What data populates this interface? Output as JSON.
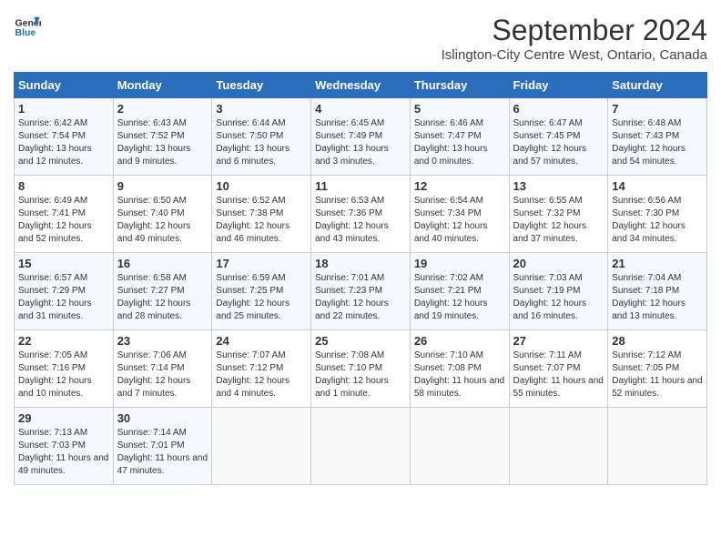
{
  "logo": {
    "line1": "General",
    "line2": "Blue"
  },
  "title": "September 2024",
  "subtitle": "Islington-City Centre West, Ontario, Canada",
  "days_header": [
    "Sunday",
    "Monday",
    "Tuesday",
    "Wednesday",
    "Thursday",
    "Friday",
    "Saturday"
  ],
  "weeks": [
    [
      {
        "num": "1",
        "sunrise": "Sunrise: 6:42 AM",
        "sunset": "Sunset: 7:54 PM",
        "daylight": "Daylight: 13 hours and 12 minutes."
      },
      {
        "num": "2",
        "sunrise": "Sunrise: 6:43 AM",
        "sunset": "Sunset: 7:52 PM",
        "daylight": "Daylight: 13 hours and 9 minutes."
      },
      {
        "num": "3",
        "sunrise": "Sunrise: 6:44 AM",
        "sunset": "Sunset: 7:50 PM",
        "daylight": "Daylight: 13 hours and 6 minutes."
      },
      {
        "num": "4",
        "sunrise": "Sunrise: 6:45 AM",
        "sunset": "Sunset: 7:49 PM",
        "daylight": "Daylight: 13 hours and 3 minutes."
      },
      {
        "num": "5",
        "sunrise": "Sunrise: 6:46 AM",
        "sunset": "Sunset: 7:47 PM",
        "daylight": "Daylight: 13 hours and 0 minutes."
      },
      {
        "num": "6",
        "sunrise": "Sunrise: 6:47 AM",
        "sunset": "Sunset: 7:45 PM",
        "daylight": "Daylight: 12 hours and 57 minutes."
      },
      {
        "num": "7",
        "sunrise": "Sunrise: 6:48 AM",
        "sunset": "Sunset: 7:43 PM",
        "daylight": "Daylight: 12 hours and 54 minutes."
      }
    ],
    [
      {
        "num": "8",
        "sunrise": "Sunrise: 6:49 AM",
        "sunset": "Sunset: 7:41 PM",
        "daylight": "Daylight: 12 hours and 52 minutes."
      },
      {
        "num": "9",
        "sunrise": "Sunrise: 6:50 AM",
        "sunset": "Sunset: 7:40 PM",
        "daylight": "Daylight: 12 hours and 49 minutes."
      },
      {
        "num": "10",
        "sunrise": "Sunrise: 6:52 AM",
        "sunset": "Sunset: 7:38 PM",
        "daylight": "Daylight: 12 hours and 46 minutes."
      },
      {
        "num": "11",
        "sunrise": "Sunrise: 6:53 AM",
        "sunset": "Sunset: 7:36 PM",
        "daylight": "Daylight: 12 hours and 43 minutes."
      },
      {
        "num": "12",
        "sunrise": "Sunrise: 6:54 AM",
        "sunset": "Sunset: 7:34 PM",
        "daylight": "Daylight: 12 hours and 40 minutes."
      },
      {
        "num": "13",
        "sunrise": "Sunrise: 6:55 AM",
        "sunset": "Sunset: 7:32 PM",
        "daylight": "Daylight: 12 hours and 37 minutes."
      },
      {
        "num": "14",
        "sunrise": "Sunrise: 6:56 AM",
        "sunset": "Sunset: 7:30 PM",
        "daylight": "Daylight: 12 hours and 34 minutes."
      }
    ],
    [
      {
        "num": "15",
        "sunrise": "Sunrise: 6:57 AM",
        "sunset": "Sunset: 7:29 PM",
        "daylight": "Daylight: 12 hours and 31 minutes."
      },
      {
        "num": "16",
        "sunrise": "Sunrise: 6:58 AM",
        "sunset": "Sunset: 7:27 PM",
        "daylight": "Daylight: 12 hours and 28 minutes."
      },
      {
        "num": "17",
        "sunrise": "Sunrise: 6:59 AM",
        "sunset": "Sunset: 7:25 PM",
        "daylight": "Daylight: 12 hours and 25 minutes."
      },
      {
        "num": "18",
        "sunrise": "Sunrise: 7:01 AM",
        "sunset": "Sunset: 7:23 PM",
        "daylight": "Daylight: 12 hours and 22 minutes."
      },
      {
        "num": "19",
        "sunrise": "Sunrise: 7:02 AM",
        "sunset": "Sunset: 7:21 PM",
        "daylight": "Daylight: 12 hours and 19 minutes."
      },
      {
        "num": "20",
        "sunrise": "Sunrise: 7:03 AM",
        "sunset": "Sunset: 7:19 PM",
        "daylight": "Daylight: 12 hours and 16 minutes."
      },
      {
        "num": "21",
        "sunrise": "Sunrise: 7:04 AM",
        "sunset": "Sunset: 7:18 PM",
        "daylight": "Daylight: 12 hours and 13 minutes."
      }
    ],
    [
      {
        "num": "22",
        "sunrise": "Sunrise: 7:05 AM",
        "sunset": "Sunset: 7:16 PM",
        "daylight": "Daylight: 12 hours and 10 minutes."
      },
      {
        "num": "23",
        "sunrise": "Sunrise: 7:06 AM",
        "sunset": "Sunset: 7:14 PM",
        "daylight": "Daylight: 12 hours and 7 minutes."
      },
      {
        "num": "24",
        "sunrise": "Sunrise: 7:07 AM",
        "sunset": "Sunset: 7:12 PM",
        "daylight": "Daylight: 12 hours and 4 minutes."
      },
      {
        "num": "25",
        "sunrise": "Sunrise: 7:08 AM",
        "sunset": "Sunset: 7:10 PM",
        "daylight": "Daylight: 12 hours and 1 minute."
      },
      {
        "num": "26",
        "sunrise": "Sunrise: 7:10 AM",
        "sunset": "Sunset: 7:08 PM",
        "daylight": "Daylight: 11 hours and 58 minutes."
      },
      {
        "num": "27",
        "sunrise": "Sunrise: 7:11 AM",
        "sunset": "Sunset: 7:07 PM",
        "daylight": "Daylight: 11 hours and 55 minutes."
      },
      {
        "num": "28",
        "sunrise": "Sunrise: 7:12 AM",
        "sunset": "Sunset: 7:05 PM",
        "daylight": "Daylight: 11 hours and 52 minutes."
      }
    ],
    [
      {
        "num": "29",
        "sunrise": "Sunrise: 7:13 AM",
        "sunset": "Sunset: 7:03 PM",
        "daylight": "Daylight: 11 hours and 49 minutes."
      },
      {
        "num": "30",
        "sunrise": "Sunrise: 7:14 AM",
        "sunset": "Sunset: 7:01 PM",
        "daylight": "Daylight: 11 hours and 47 minutes."
      },
      null,
      null,
      null,
      null,
      null
    ]
  ]
}
